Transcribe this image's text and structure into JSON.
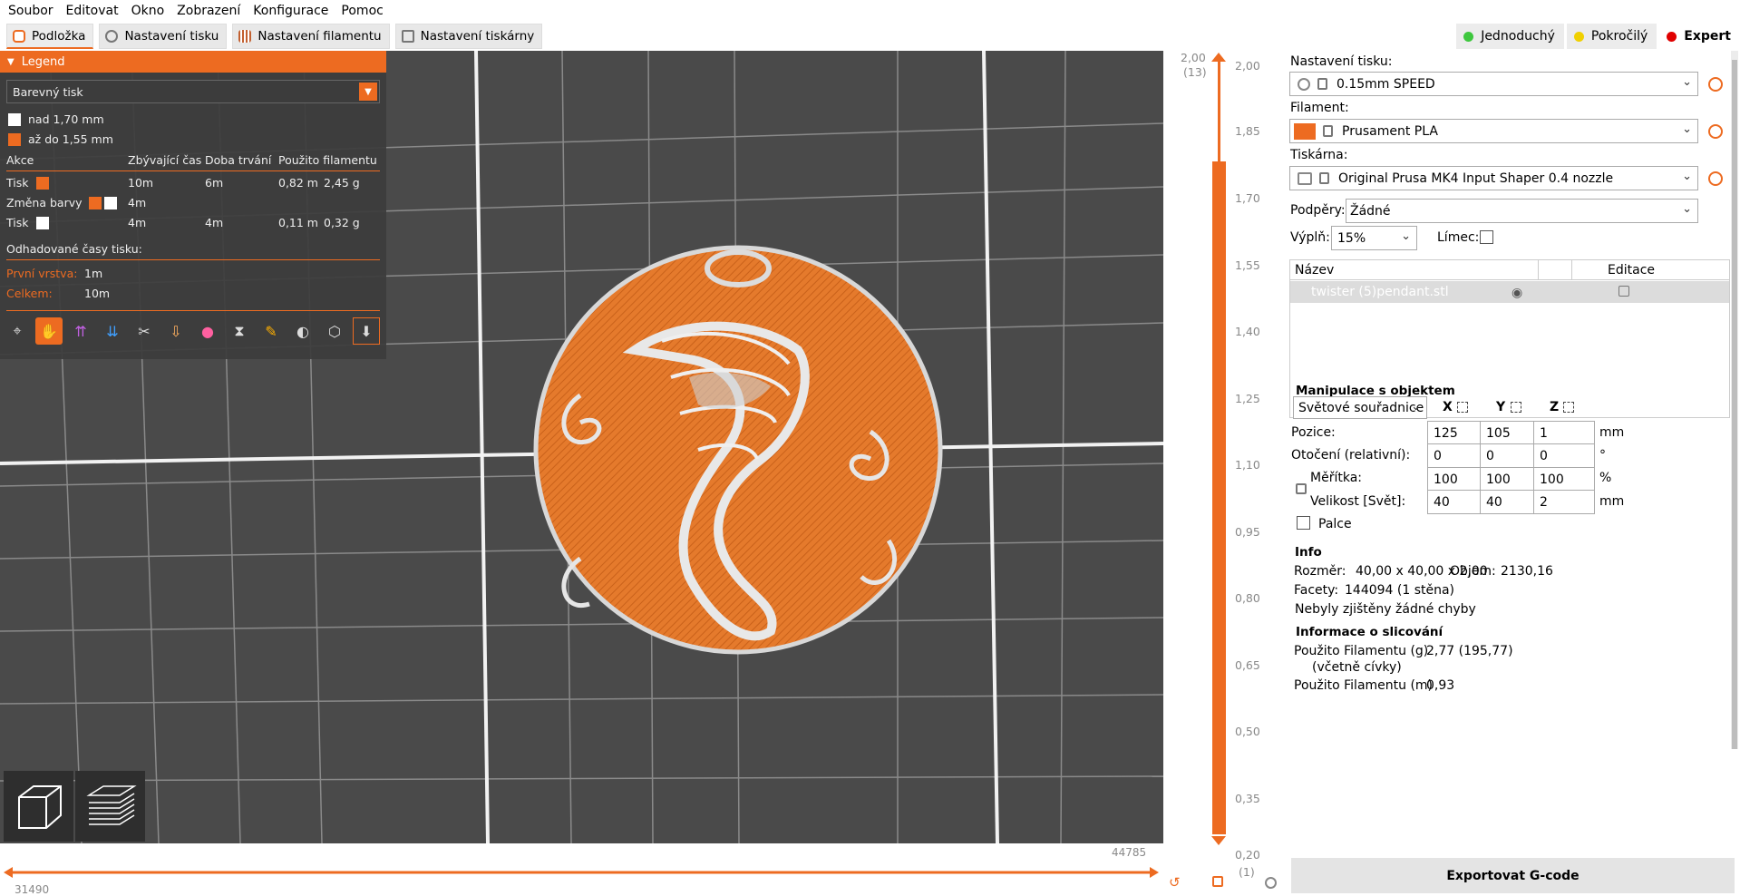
{
  "menu": [
    "Soubor",
    "Editovat",
    "Okno",
    "Zobrazení",
    "Konfigurace",
    "Pomoc"
  ],
  "tabs": [
    {
      "label": "Podložka"
    },
    {
      "label": "Nastavení tisku"
    },
    {
      "label": "Nastavení filamentu"
    },
    {
      "label": "Nastavení tiskárny"
    }
  ],
  "modes": [
    {
      "label": "Jednoduchý",
      "color": "#3ec73e"
    },
    {
      "label": "Pokročilý",
      "color": "#f0d000"
    },
    {
      "label": "Expert",
      "color": "#e00000"
    }
  ],
  "legend": {
    "title": "Legend",
    "view_type": "Barevný tisk",
    "items": [
      {
        "label": "nad 1,70 mm",
        "color": "#ffffff"
      },
      {
        "label": "až do 1,55 mm",
        "color": "#ed6b21"
      }
    ],
    "headers": [
      "Akce",
      "Zbývající čas",
      "Doba trvání",
      "Použito filamentu"
    ],
    "rows": [
      {
        "action": "Tisk",
        "remaining": "10m",
        "duration": "6m",
        "length": "0,82 m",
        "weight": "2,45 g"
      },
      {
        "action": "Změna barvy",
        "remaining": "4m",
        "duration": "",
        "length": "",
        "weight": ""
      },
      {
        "action": "Tisk",
        "remaining": "4m",
        "duration": "4m",
        "length": "0,11 m",
        "weight": "0,32 g"
      }
    ],
    "estimate_label": "Odhadované časy tisku:",
    "first_layer_label": "První vrstva:",
    "first_layer": "1m",
    "total_label": "Celkem:",
    "total": "10m"
  },
  "slider": {
    "top_value": "2,00",
    "top_layer": "(13)",
    "ticks": [
      "2,00",
      "1,85",
      "1,70",
      "1,55",
      "1,40",
      "1,25",
      "1,10",
      "0,95",
      "0,80",
      "0,65",
      "0,50",
      "0,35",
      "0,20"
    ],
    "bottom_layer": "(1)",
    "h_left": "31490",
    "h_right": "44785"
  },
  "panel": {
    "print_label": "Nastavení tisku:",
    "print_value": "0.15mm SPEED",
    "filament_label": "Filament:",
    "filament_value": "Prusament PLA",
    "filament_color": "#ed6b21",
    "printer_label": "Tiskárna:",
    "printer_value": "Original Prusa MK4 Input Shaper 0.4 nozzle",
    "supports_label": "Podpěry:",
    "supports_value": "Žádné",
    "infill_label": "Výplň:",
    "infill_value": "15%",
    "brim_label": "Límec:",
    "list_headers": [
      "Název",
      "Editace"
    ],
    "object_name": "twister (5)pendant.stl",
    "manip_title": "Manipulace s objektem",
    "coord_system": "Světové souřadnice",
    "axes": [
      "X",
      "Y",
      "Z"
    ],
    "position_label": "Pozice:",
    "position": [
      "125",
      "105",
      "1"
    ],
    "position_unit": "mm",
    "rotation_label": "Otočení (relativní):",
    "rotation": [
      "0",
      "0",
      "0"
    ],
    "rotation_unit": "°",
    "scale_label": "Měřítka:",
    "scale": [
      "100",
      "100",
      "100"
    ],
    "scale_unit": "%",
    "size_label": "Velikost [Svět]:",
    "size": [
      "40",
      "40",
      "2"
    ],
    "size_unit": "mm",
    "inches_label": "Palce",
    "info_title": "Info",
    "dim_label": "Rozměr:",
    "dim_value": "40,00 x 40,00 x 2,00",
    "vol_label": "Objem:",
    "vol_value": "2130,16",
    "facets_label": "Facety:",
    "facets_value": "144094 (1 stěna)",
    "errors": "Nebyly zjištěny žádné chyby",
    "slice_title": "Informace o slicování",
    "used_g_label": "Použito Filamentu (g)",
    "used_g_sub": "(včetně cívky)",
    "used_g": "2,77 (195,77)",
    "used_m_label": "Použito Filamentu (m)",
    "used_m": "0,93",
    "export": "Exportovat G-code"
  }
}
